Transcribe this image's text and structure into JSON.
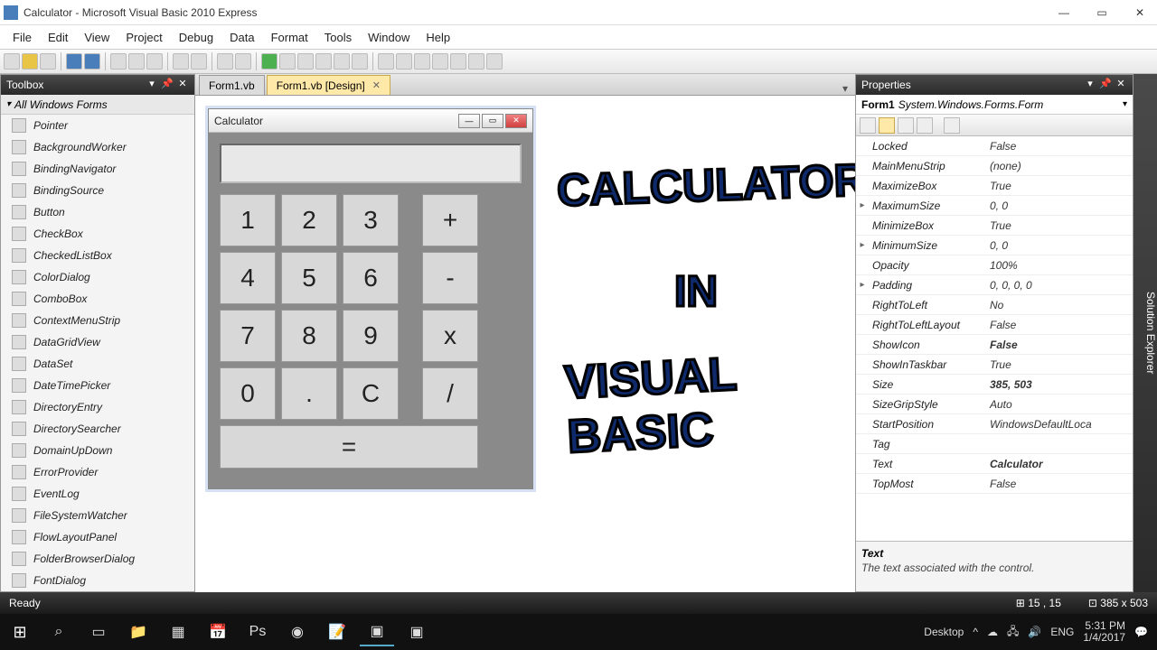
{
  "window": {
    "title": "Calculator - Microsoft Visual Basic 2010 Express"
  },
  "menu": [
    "File",
    "Edit",
    "View",
    "Project",
    "Debug",
    "Data",
    "Format",
    "Tools",
    "Window",
    "Help"
  ],
  "toolbox": {
    "title": "Toolbox",
    "category": "All Windows Forms",
    "items": [
      "Pointer",
      "BackgroundWorker",
      "BindingNavigator",
      "BindingSource",
      "Button",
      "CheckBox",
      "CheckedListBox",
      "ColorDialog",
      "ComboBox",
      "ContextMenuStrip",
      "DataGridView",
      "DataSet",
      "DateTimePicker",
      "DirectoryEntry",
      "DirectorySearcher",
      "DomainUpDown",
      "ErrorProvider",
      "EventLog",
      "FileSystemWatcher",
      "FlowLayoutPanel",
      "FolderBrowserDialog",
      "FontDialog"
    ]
  },
  "tabs": [
    {
      "label": "Form1.vb",
      "active": false
    },
    {
      "label": "Form1.vb [Design]",
      "active": true
    }
  ],
  "form": {
    "title": "Calculator"
  },
  "calc": {
    "keys": [
      "1",
      "2",
      "3",
      "+",
      "4",
      "5",
      "6",
      "-",
      "7",
      "8",
      "9",
      "x",
      "0",
      ".",
      "C",
      "/"
    ],
    "equals": "="
  },
  "overlay": {
    "line1": "CALCULATOR",
    "line2": "IN",
    "line3": "VISUAL BASIC"
  },
  "properties": {
    "title": "Properties",
    "object_name": "Form1",
    "object_type": "System.Windows.Forms.Form",
    "rows": [
      {
        "name": "Locked",
        "value": "False"
      },
      {
        "name": "MainMenuStrip",
        "value": "(none)"
      },
      {
        "name": "MaximizeBox",
        "value": "True"
      },
      {
        "name": "MaximumSize",
        "value": "0, 0",
        "exp": true
      },
      {
        "name": "MinimizeBox",
        "value": "True"
      },
      {
        "name": "MinimumSize",
        "value": "0, 0",
        "exp": true
      },
      {
        "name": "Opacity",
        "value": "100%"
      },
      {
        "name": "Padding",
        "value": "0, 0, 0, 0",
        "exp": true
      },
      {
        "name": "RightToLeft",
        "value": "No"
      },
      {
        "name": "RightToLeftLayout",
        "value": "False"
      },
      {
        "name": "ShowIcon",
        "value": "False",
        "bold": true
      },
      {
        "name": "ShowInTaskbar",
        "value": "True"
      },
      {
        "name": "Size",
        "value": "385, 503",
        "bold": true
      },
      {
        "name": "SizeGripStyle",
        "value": "Auto"
      },
      {
        "name": "StartPosition",
        "value": "WindowsDefaultLoca"
      },
      {
        "name": "Tag",
        "value": ""
      },
      {
        "name": "Text",
        "value": "Calculator",
        "bold": true
      },
      {
        "name": "TopMost",
        "value": "False"
      }
    ],
    "desc_name": "Text",
    "desc_text": "The text associated with the control."
  },
  "solution_explorer": "Solution Explorer",
  "status": {
    "ready": "Ready",
    "pos": "15 , 15",
    "size": "385 x 503"
  },
  "taskbar": {
    "desktop": "Desktop",
    "lang": "ENG",
    "time": "5:31 PM",
    "date": "1/4/2017"
  }
}
